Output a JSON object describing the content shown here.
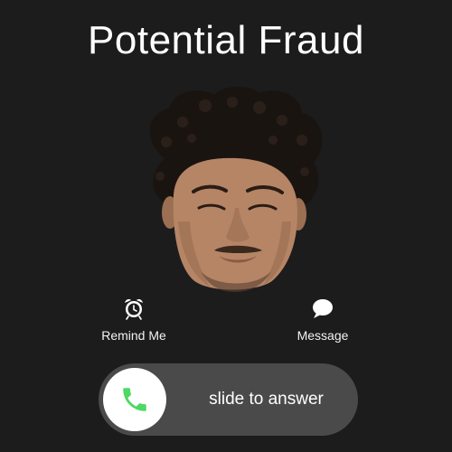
{
  "call": {
    "caller_name": "Potential Fraud"
  },
  "actions": [
    {
      "label": "Remind Me",
      "icon": "alarm-clock-icon"
    },
    {
      "label": "Message",
      "icon": "message-bubble-icon"
    }
  ],
  "slider": {
    "label": "slide to answer",
    "icon": "phone-icon",
    "accent_color": "#4cd964"
  },
  "colors": {
    "background": "#1c1c1c",
    "slider_track": "#4a4a4a"
  }
}
